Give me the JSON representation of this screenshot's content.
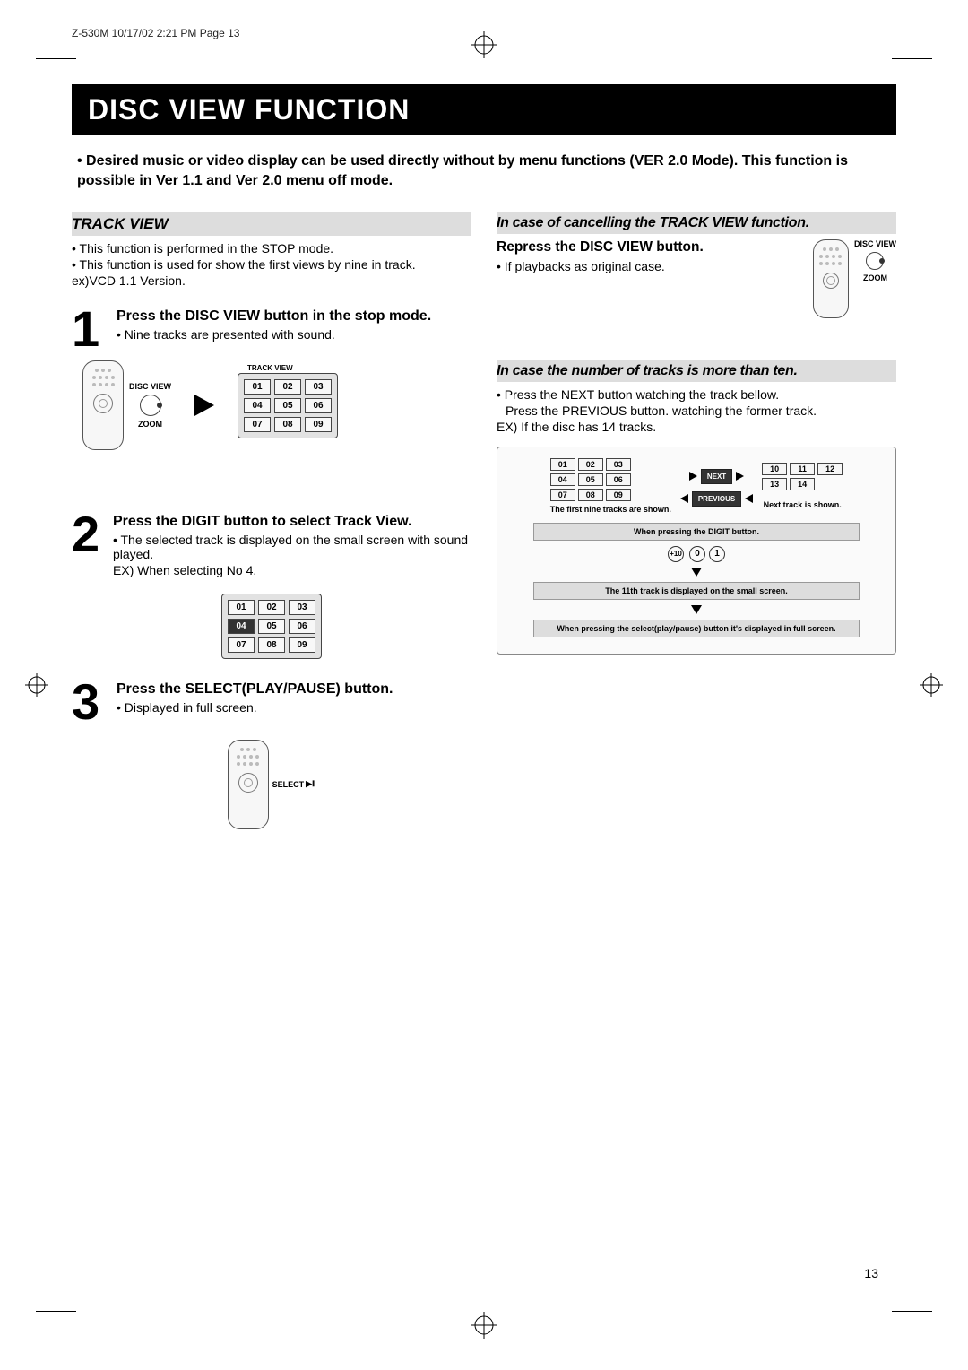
{
  "header": "Z-530M  10/17/02 2:21 PM  Page 13",
  "title": "DISC VIEW FUNCTION",
  "intro": "• Desired music or video display can be used directly without by menu functions (VER 2.0 Mode). This function is possible in Ver 1.1 and Ver 2.0 menu off mode.",
  "left": {
    "h_trackview": "TRACK VIEW",
    "bul1": "• This function is performed in the STOP mode.",
    "bul2": "• This function is used for show the first views by nine in track.",
    "bul3": "ex)VCD 1.1 Version.",
    "step1_title": "Press the DISC VIEW button in the stop mode.",
    "step1_sub": "• Nine tracks are presented with sound.",
    "step2_title": "Press the DIGIT button  to select Track View.",
    "step2_sub1": "• The selected track is displayed on the small screen with sound played.",
    "step2_sub2": "EX) When selecting No 4.",
    "step3_title": "Press the SELECT(PLAY/PAUSE) button.",
    "step3_sub": "• Displayed in full screen.",
    "remote_discview": "DISC VIEW",
    "remote_zoom": "ZOOM",
    "track_label": "TRACK VIEW",
    "grid": [
      "01",
      "02",
      "03",
      "04",
      "05",
      "06",
      "07",
      "08",
      "09"
    ],
    "select_label": "SELECT"
  },
  "right": {
    "h_cancel": "In case of cancelling the TRACK VIEW function.",
    "sub_repress": "Repress the DISC VIEW button.",
    "bul_playback": "• If playbacks as original case.",
    "h_more10": "In case the number of tracks is more than ten.",
    "bul_next": "• Press the NEXT button watching the track bellow.",
    "bul_prev": "Press the PREVIOUS button. watching the former track.",
    "bul_ex": "EX) If the disc has 14 tracks.",
    "gridA": [
      "01",
      "02",
      "03",
      "04",
      "05",
      "06",
      "07",
      "08",
      "09"
    ],
    "gridB": [
      "10",
      "11",
      "12",
      "13",
      "14"
    ],
    "tag_next": "NEXT",
    "tag_prev": "PREVIOUS",
    "cap_first9": "The first nine tracks are shown.",
    "cap_nextshown": "Next track is shown.",
    "bar_digit": "When pressing the DIGIT button.",
    "digit_plus10": "+10",
    "digit0": "0",
    "digit1": "1",
    "bar_11th": "The 11th track is displayed on the small screen.",
    "bar_select": "When pressing the select(play/pause) button it's displayed in full screen."
  },
  "pagenum": "13"
}
